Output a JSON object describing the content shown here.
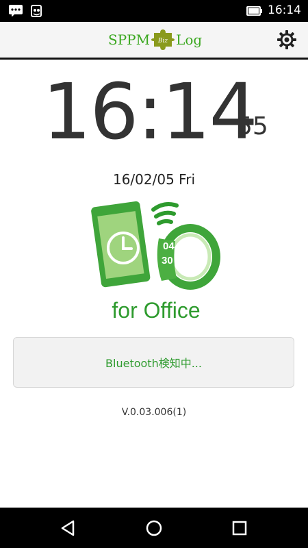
{
  "status_bar": {
    "time": "16:14",
    "icons": [
      "message-icon",
      "notification-icon",
      "battery-icon"
    ]
  },
  "app_bar": {
    "logo_left": "SPPM",
    "logo_badge": "Biz",
    "logo_right": "Log",
    "settings_icon": "gear-icon"
  },
  "clock": {
    "hours_minutes": "16:14",
    "seconds": "55",
    "date": "16/02/05 Fri"
  },
  "illustration": {
    "watch_hour": "04",
    "watch_minute": "30",
    "caption": "for Office"
  },
  "status_button": {
    "label": "Bluetooth検知中..."
  },
  "version": "V.0.03.006(1)",
  "nav": {
    "back": "back-icon",
    "home": "home-icon",
    "recents": "recents-icon"
  },
  "colors": {
    "brand_green": "#3ba820",
    "status_text_green": "#2e9b2e"
  }
}
